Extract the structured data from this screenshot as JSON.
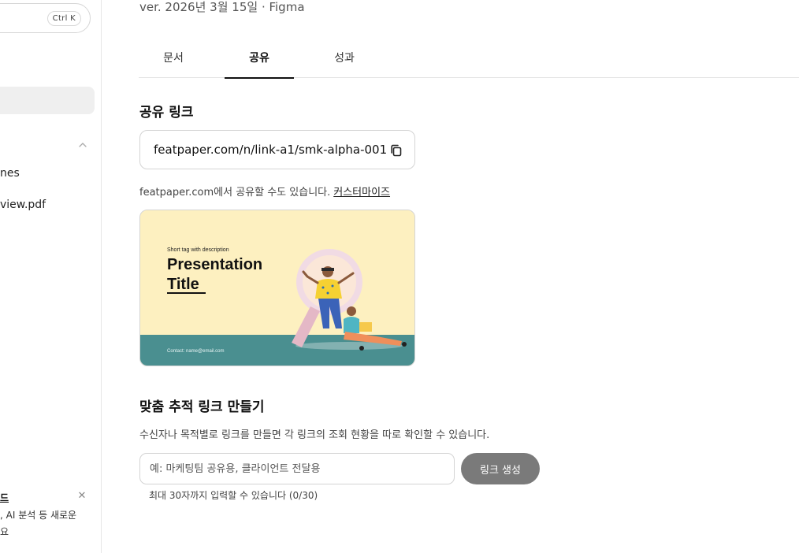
{
  "sidebar": {
    "search_shortcut": "Ctrl K",
    "files": [
      {
        "label": "nes"
      },
      {
        "label": "view.pdf"
      }
    ],
    "promo": {
      "title": "드",
      "line1": ", AI 분석 등 새로운",
      "line2": "요"
    }
  },
  "header": {
    "version": "ver. 2026년 3월 15일 · Figma"
  },
  "tabs": [
    {
      "label": "문서"
    },
    {
      "label": "공유",
      "active": true
    },
    {
      "label": "성과"
    }
  ],
  "share": {
    "title": "공유 링크",
    "link": "featpaper.com/n/link-a1/smk-alpha-001",
    "helper": "featpaper.com에서 공유할 수도 있습니다.",
    "customize_label": "커스터마이즈",
    "preview": {
      "tag": "Short tag  with description",
      "title_line1": "Presentation",
      "title_line2": "Title",
      "contact": "Contact: name@email.com",
      "colors": {
        "background": "#fdf0c0",
        "footer": "#4a8f90"
      }
    }
  },
  "tracking": {
    "title": "맞춤 추적 링크 만들기",
    "description": "수신자나 목적별로 링크를 만들면 각 링크의 조회 현황을 따로 확인할 수 있습니다.",
    "input_placeholder": "예: 마케팅팀 공유용, 클라이언트 전달용",
    "input_value": "",
    "button_label": "링크 생성",
    "hint": "최대 30자까지 입력할 수 있습니다 (0/30)"
  },
  "icons": {
    "copy": "copy-icon",
    "chevron": "chevron-up-icon",
    "close": "close-icon"
  }
}
